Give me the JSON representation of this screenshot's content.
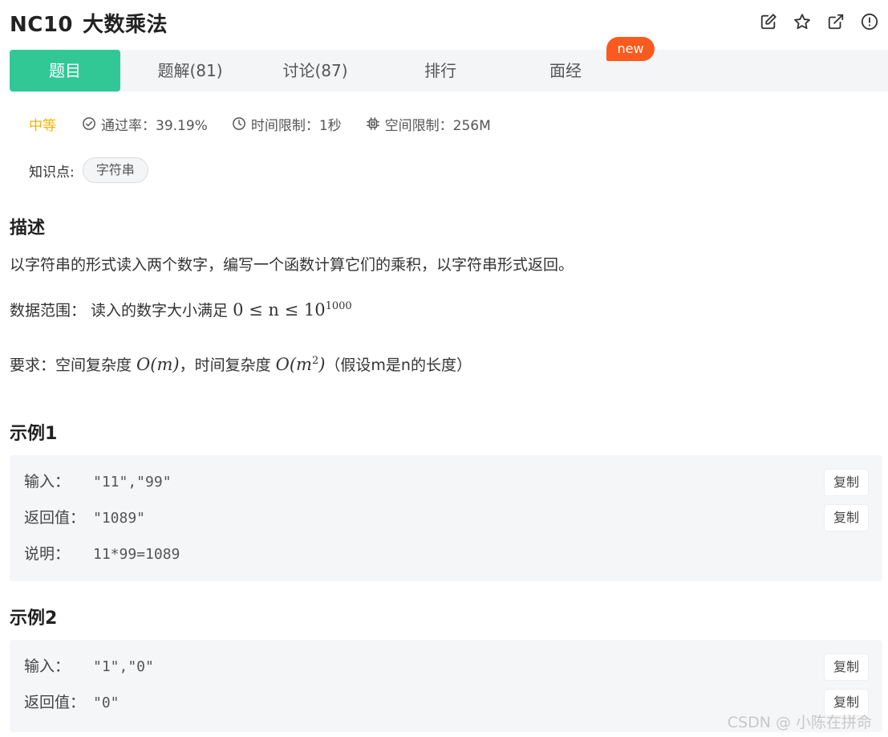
{
  "problem": {
    "id": "NC10",
    "name": "大数乘法"
  },
  "header_icons": [
    "edit-icon",
    "star-icon",
    "external-link-icon",
    "report-icon"
  ],
  "tabs": [
    {
      "label": "题目",
      "active": true
    },
    {
      "label": "题解(81)",
      "active": false
    },
    {
      "label": "讨论(87)",
      "active": false
    },
    {
      "label": "排行",
      "active": false
    },
    {
      "label": "面经",
      "active": false
    }
  ],
  "new_badge": "new",
  "meta": {
    "difficulty": "中等",
    "pass_rate": "通过率：39.19%",
    "time_limit": "时间限制：1秒",
    "space_limit": "空间限制：256M"
  },
  "knowledge": {
    "label": "知识点:",
    "tag": "字符串"
  },
  "description": {
    "title": "描述",
    "text": "以字符串的形式读入两个数字，编写一个函数计算它们的乘积，以字符串形式返回。",
    "range_prefix": "数据范围： 读入的数字大小满足 ",
    "range_math": "0 ≤ n ≤ 10",
    "range_exp": "1000",
    "req_prefix": "要求：空间复杂度 ",
    "req_space": "O(m)",
    "req_mid": "，时间复杂度 ",
    "req_time": "O(m",
    "req_time_exp": "2",
    "req_time_close": ")",
    "req_suffix": "（假设m是n的长度）"
  },
  "examples": [
    {
      "title": "示例1",
      "input_label": "输入：",
      "input_value": "\"11\",\"99\"",
      "output_label": "返回值：",
      "output_value": "\"1089\"",
      "note_label": "说明：",
      "note_value": "11*99=1089",
      "copy_label": "复制"
    },
    {
      "title": "示例2",
      "input_label": "输入：",
      "input_value": "\"1\",\"0\"",
      "output_label": "返回值：",
      "output_value": "\"0\"",
      "copy_label": "复制"
    }
  ],
  "watermark": "CSDN @   小陈在拼命",
  "colors": {
    "accent": "#32c896",
    "badge": "#fa5a1e",
    "difficulty": "#f0b400"
  }
}
